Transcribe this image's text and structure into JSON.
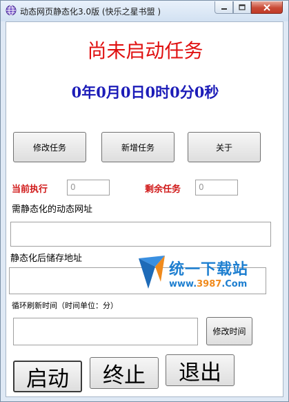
{
  "window": {
    "title": "动态网页静态化3.0版 (快乐之星书盟 )"
  },
  "status": {
    "message": "尚未启动任务",
    "elapsed": "0年0月0日0时0分0秒"
  },
  "actions": {
    "modify_task": "修改任务",
    "add_task": "新增任务",
    "about": "关于"
  },
  "counters": {
    "current_label": "当前执行",
    "current_value": "0",
    "remaining_label": "剩余任务",
    "remaining_value": "0"
  },
  "form": {
    "source_url_label": "需静态化的动态网址",
    "source_url_value": "",
    "save_path_label": "静态化后储存地址",
    "save_path_value": "",
    "interval_label": "循环刷新时间（时间单位：分）",
    "interval_value": "",
    "modify_time_button": "修改时间"
  },
  "controls": {
    "start": "启动",
    "stop": "终止",
    "exit": "退出"
  },
  "watermark": {
    "text": "统一下载站",
    "url_prefix": "www.",
    "url_number": "3987",
    "url_suffix": ".Com"
  },
  "colors": {
    "status_red": "#e01010",
    "elapsed_blue": "#1c1cb8",
    "label_red": "#d01818",
    "watermark_blue": "#1e7fd0",
    "watermark_orange": "#f08a1c"
  }
}
